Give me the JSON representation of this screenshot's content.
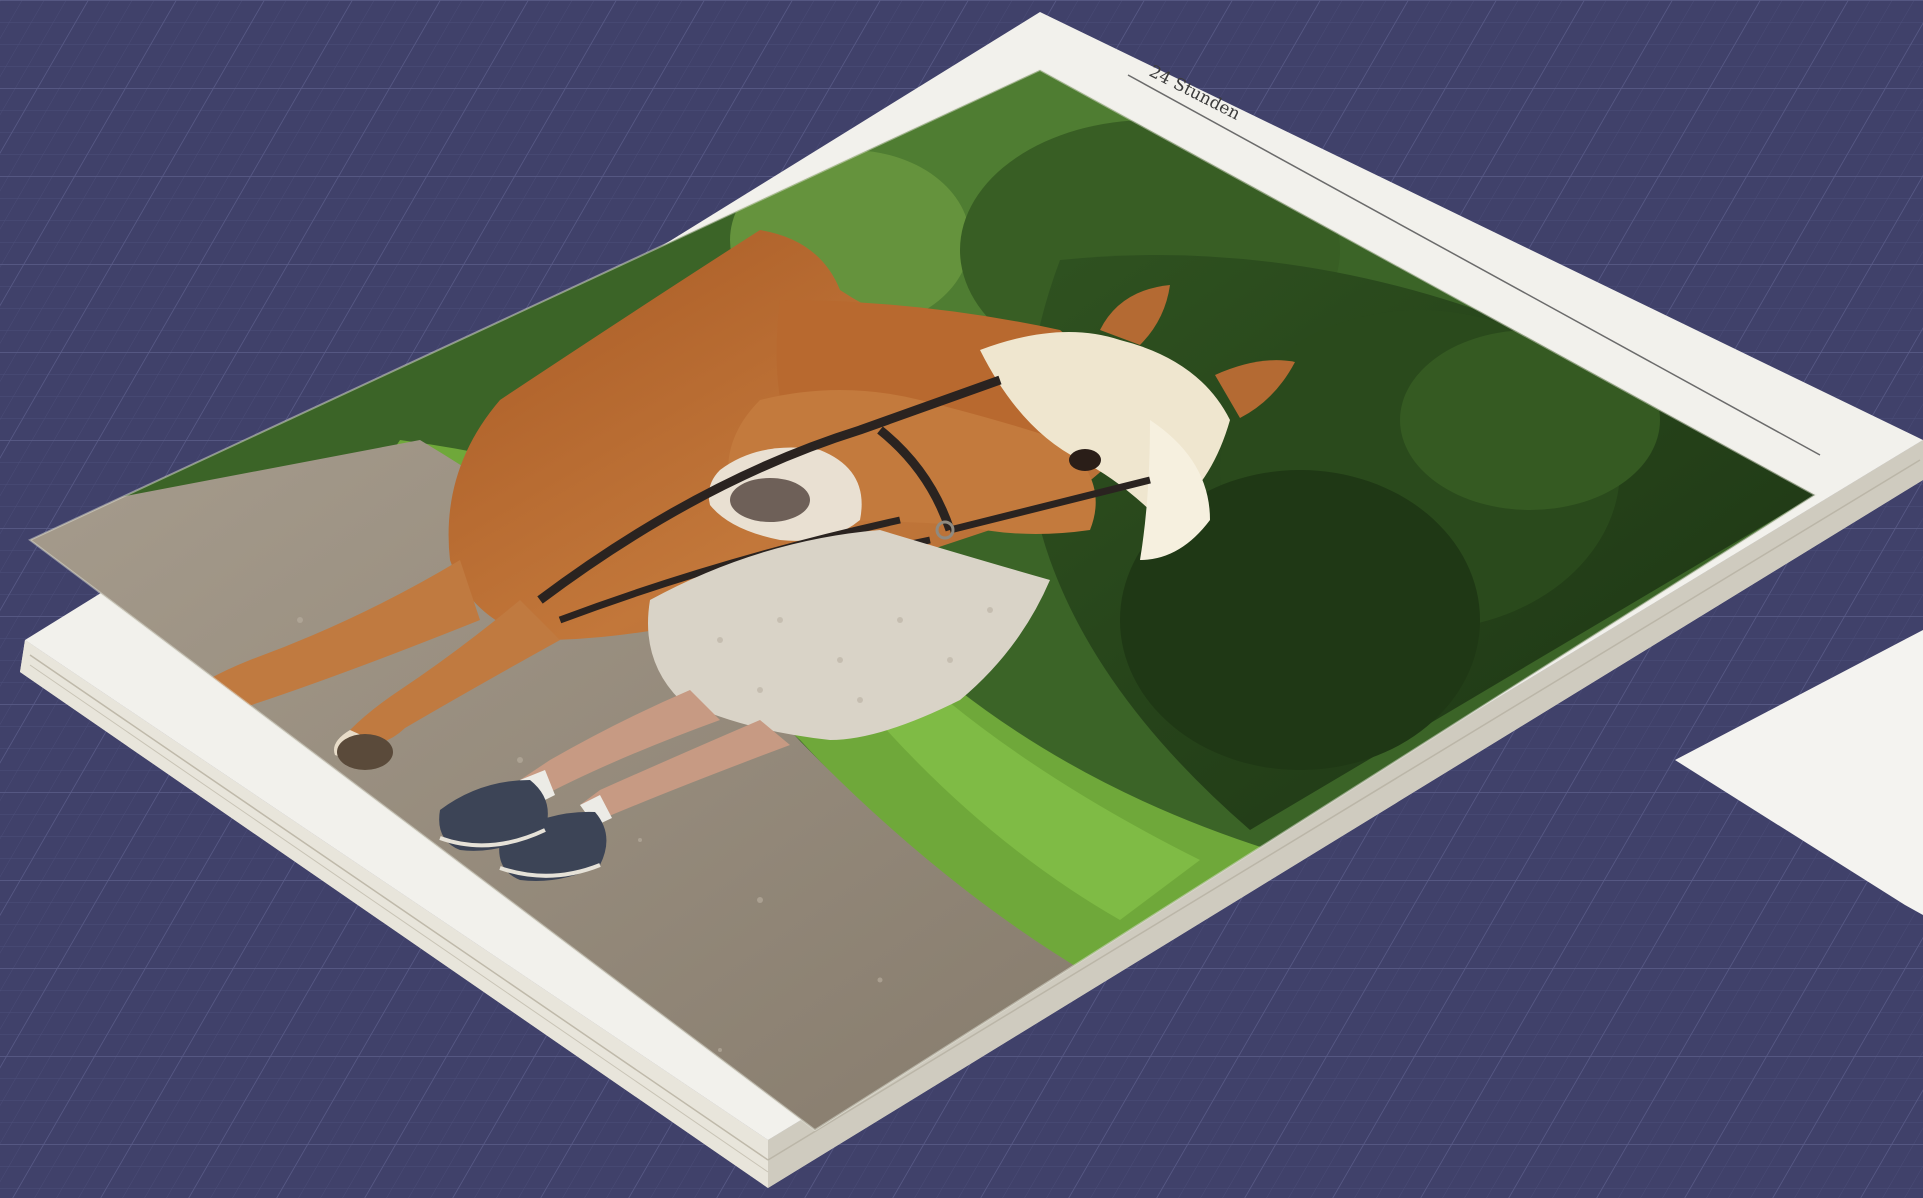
{
  "book": {
    "header_text": "24 Stunden"
  },
  "colors": {
    "background": "#40416a",
    "grid_line": "#5a5c88",
    "grid_line_minor": "#4b4d78",
    "paper": "#f2f1ec",
    "page_edge": "#dcd8cc",
    "header_rule": "#6b6b6b",
    "header_text": "#3a3a3a",
    "sky_foliage": "#3f6b2a",
    "hedge_dark": "#233d18",
    "grass": "#6fa83a",
    "gravel": "#9a8f80",
    "horse_coat": "#b8692f",
    "horse_mane": "#efe6cf",
    "bridle": "#2a2320",
    "dress": "#d9d3c7",
    "legs": "#c79a83",
    "shoes": "#3c4456"
  }
}
